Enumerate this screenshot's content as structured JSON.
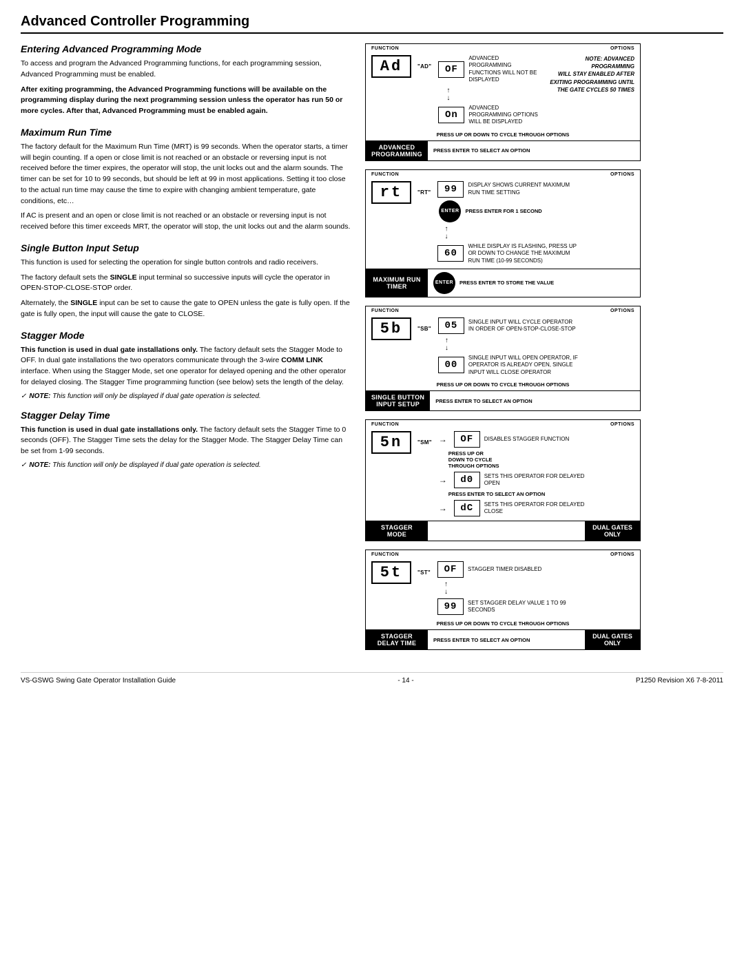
{
  "page": {
    "title": "Advanced Controller Programming",
    "footer_left": "VS-GSWG   Swing Gate Operator Installation Guide",
    "footer_center": "- 14 -",
    "footer_right": "P1250 Revision X6  7-8-2011"
  },
  "sections": [
    {
      "id": "entering",
      "heading": "Entering Advanced Programming Mode",
      "body": [
        {
          "text": "To access and program the Advanced Programming functions, for each programming session, Advanced Programming must be enabled.",
          "bold": false
        },
        {
          "text": "After exiting programming, the Advanced Programming functions will be available on the programming display during the next programming session unless the operator has run 50 or more cycles. After that, Advanced Programming must be enabled again.",
          "bold": true
        }
      ]
    },
    {
      "id": "mrt",
      "heading": "Maximum Run Time",
      "body": [
        {
          "text": "The factory default for the Maximum Run Time (MRT) is 99 seconds. When the operator starts, a timer will begin counting. If a open or close limit is not reached or an obstacle or reversing input is not received before the timer expires, the operator will stop, the unit locks out and the alarm sounds. The timer can be set for 10 to 99 seconds, but should be left at 99 in most applications. Setting it too close to the actual run time may cause the time to expire with changing ambient temperature, gate conditions, etc…",
          "bold": false
        },
        {
          "text": "If AC is present and an open or close limit is not reached or an obstacle or reversing input is not received before this timer exceeds MRT, the operator will stop, the unit locks out and the alarm sounds.",
          "bold": false
        }
      ]
    },
    {
      "id": "sbi",
      "heading": "Single Button Input Setup",
      "body": [
        {
          "text": "This function is used for selecting the operation for single button controls and radio receivers.",
          "bold": false
        },
        {
          "text": "The factory default sets the SINGLE input terminal so successive inputs will cycle the operator in OPEN-STOP-CLOSE-STOP order.",
          "bold": false,
          "inline_bold": "SINGLE"
        },
        {
          "text": "Alternately, the SINGLE input can be set to cause the gate to OPEN unless the gate is fully open. If the gate is fully open, the input will cause the gate to CLOSE.",
          "bold": false,
          "inline_bold": "SINGLE"
        }
      ]
    },
    {
      "id": "stagger",
      "heading": "Stagger Mode",
      "body": [
        {
          "text": "This function is used in dual gate installations only. The factory default sets the Stagger Mode to OFF. In dual gate installations the two operators communicate through the 3-wire COMM LINK interface. When using the Stagger Mode, set one operator for delayed opening and the other operator for delayed closing. The Stagger Time programming function (see below) sets the length of the delay.",
          "bold": false,
          "bold_prefix": true
        },
        {
          "text": "NOTE: This function will only be displayed if dual gate operation is selected.",
          "italic": true,
          "note": true
        }
      ]
    },
    {
      "id": "sdt",
      "heading": "Stagger Delay Time",
      "body": [
        {
          "text": "This function is used in dual gate installations only. The factory default sets the Stagger Time to 0 seconds (OFF). The Stagger Time sets the delay for the Stagger Mode. The Stagger Delay Time can be set from 1-99 seconds.",
          "bold": false,
          "bold_prefix": true
        },
        {
          "text": "NOTE: This function will only be displayed if dual gate operation is selected.",
          "italic": true,
          "note": true
        }
      ]
    }
  ],
  "diagrams": [
    {
      "id": "advanced-programming",
      "function_label": "FUNCTION",
      "options_label": "OPTIONS",
      "func_display": "Ad",
      "func_code": "\"AD\"",
      "options": [
        {
          "display": "OF",
          "text": "ADVANCED PROGRAMMING FUNCTIONS WILL NOT BE DISPLAYED"
        },
        {
          "display": "On",
          "text": "ADVANCED PROGRAMMING OPTIONS WILL BE DISPLAYED"
        }
      ],
      "press_instructions": "PRESS UP OR\nDOWN TO CYCLE\nTHROUGH OPTIONS",
      "note_italic": "NOTE: ADVANCED PROGRAMMING\nWILL STAY ENABLED AFTER\nEXITING PROGRAMMING UNTIL\nTHE GATE CYCLES 50 TIMES",
      "footer_left": "ADVANCED\nPROGRAMMING",
      "footer_right": "PRESS ENTER TO\nSELECT AN OPTION",
      "dual_gates": false
    },
    {
      "id": "maximum-run-timer",
      "function_label": "FUNCTION",
      "options_label": "OPTIONS",
      "func_display": "rt",
      "func_code": "\"RT\"",
      "options": [
        {
          "display": "99",
          "text": "DISPLAY SHOWS CURRENT MAXIMUM RUN TIME SETTING"
        },
        {
          "display": "60",
          "text": "WHILE DISPLAY IS FLASHING, PRESS UP OR DOWN TO CHANGE THE MAXIMUM RUN TIME (10-99 SECONDS)"
        }
      ],
      "has_enter": true,
      "enter_text": "PRESS ENTER FOR 1 SECOND",
      "press_instructions_bottom": "PRESS ENTER TO STORE THE VALUE",
      "footer_left": "MAXIMUM RUN\nTIMER",
      "footer_right": "",
      "dual_gates": false
    },
    {
      "id": "single-button-input",
      "function_label": "FUNCTION",
      "options_label": "OPTIONS",
      "func_display": "5b",
      "func_code": "\"SB\"",
      "options": [
        {
          "display": "05",
          "text": "SINGLE INPUT WILL CYCLE OPERATOR IN ORDER OF OPEN-STOP-CLOSE-STOP"
        },
        {
          "display": "00",
          "text": "SINGLE INPUT WILL OPEN OPERATOR, IF OPERATOR IS ALREADY OPEN, SINGLE INPUT WILL CLOSE OPERATOR"
        }
      ],
      "press_instructions": "PRESS UP OR\nDOWN TO CYCLE\nTHROUGH OPTIONS",
      "footer_left": "SINGLE BUTTON\nINPUT SETUP",
      "footer_right": "PRESS ENTER TO\nSELECT AN OPTION",
      "dual_gates": false
    },
    {
      "id": "stagger-mode",
      "function_label": "FUNCTION",
      "options_label": "OPTIONS",
      "func_display": "5n",
      "func_code": "\"SM\"",
      "options": [
        {
          "display": "OF",
          "text": "DISABLES STAGGER FUNCTION"
        },
        {
          "display": "d0",
          "text": "SETS THIS OPERATOR FOR DELAYED OPEN"
        },
        {
          "display": "dC",
          "text": "SETS THIS OPERATOR FOR DELAYED CLOSE"
        }
      ],
      "press_instructions": "PRESS UP OR\nDOWN TO CYCLE\nTHROUGH OPTIONS",
      "footer_left": "STAGGER\nMODE",
      "footer_right": "DUAL GATES\nONLY",
      "dual_gates": true
    },
    {
      "id": "stagger-delay-time",
      "function_label": "FUNCTION",
      "options_label": "OPTIONS",
      "func_display": "5t",
      "func_code": "\"ST\"",
      "options": [
        {
          "display": "OF",
          "text": "STAGGER TIMER DISABLED"
        },
        {
          "display": "99",
          "text": "SET STAGGER DELAY VALUE 1 TO 99 SECONDS"
        }
      ],
      "press_instructions": "PRESS UP OR\nDOWN TO CYCLE\nTHROUGH OPTIONS",
      "footer_left": "STAGGER\nDELAY TIME",
      "footer_right": "DUAL GATES\nONLY",
      "footer_middle": "PRESS ENTER TO\nSELECT AN OPTION",
      "dual_gates": true
    }
  ]
}
